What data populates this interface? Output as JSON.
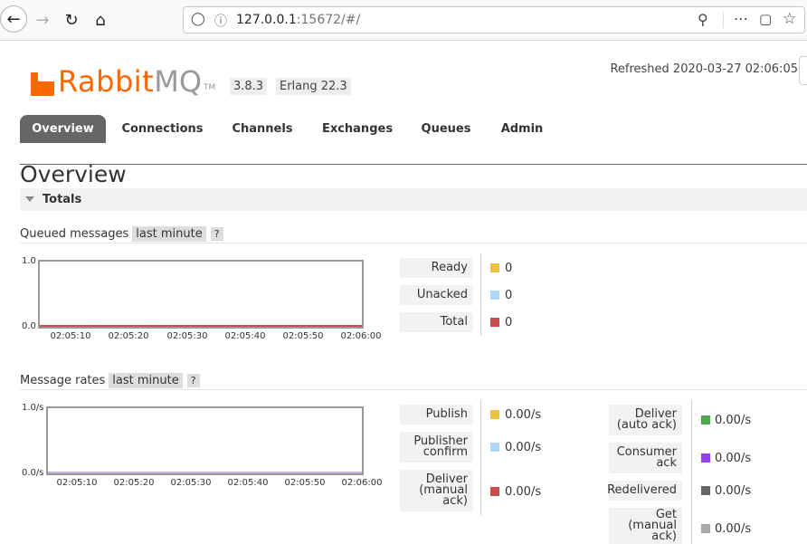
{
  "browser": {
    "url_host": "127.0.0.1",
    "url_rest": ":15672/#/"
  },
  "header": {
    "logo_text_1": "Rabbit",
    "logo_text_2": "MQ",
    "logo_tm": "TM",
    "version": "3.8.3",
    "erlang": "Erlang 22.3",
    "refreshed": "Refreshed 2020-03-27 02:06:05"
  },
  "tabs": [
    {
      "label": "Overview",
      "active": true
    },
    {
      "label": "Connections",
      "active": false
    },
    {
      "label": "Channels",
      "active": false
    },
    {
      "label": "Exchanges",
      "active": false
    },
    {
      "label": "Queues",
      "active": false
    },
    {
      "label": "Admin",
      "active": false
    }
  ],
  "page_title": "Overview",
  "section_totals": "Totals",
  "queued": {
    "label": "Queued messages",
    "range": "last minute",
    "help": "?",
    "y_top": "1.0",
    "y_bottom": "0.0",
    "x_ticks": [
      "02:05:10",
      "02:05:20",
      "02:05:30",
      "02:05:40",
      "02:05:50",
      "02:06:00"
    ],
    "legend": [
      {
        "label": "Ready",
        "value": "0",
        "color": "#edc240"
      },
      {
        "label": "Unacked",
        "value": "0",
        "color": "#afd8f8"
      },
      {
        "label": "Total",
        "value": "0",
        "color": "#cb4b4b"
      }
    ]
  },
  "rates": {
    "label": "Message rates",
    "range": "last minute",
    "help": "?",
    "y_top": "1.0/s",
    "y_bottom": "0.0/s",
    "x_ticks": [
      "02:05:10",
      "02:05:20",
      "02:05:30",
      "02:05:40",
      "02:05:50",
      "02:06:00"
    ],
    "legend_left": [
      {
        "lines": [
          "Publish"
        ],
        "value": "0.00/s",
        "color": "#edc240"
      },
      {
        "lines": [
          "Publisher",
          "confirm"
        ],
        "value": "0.00/s",
        "color": "#afd8f8"
      },
      {
        "lines": [
          "Deliver",
          "(manual",
          "ack)"
        ],
        "value": "0.00/s",
        "color": "#cb4b4b"
      }
    ],
    "legend_right": [
      {
        "lines": [
          "Deliver",
          "(auto ack)"
        ],
        "value": "0.00/s",
        "color": "#4da74d"
      },
      {
        "lines": [
          "Consumer",
          "ack"
        ],
        "value": "0.00/s",
        "color": "#9440ed"
      },
      {
        "lines": [
          "Redelivered"
        ],
        "value": "0.00/s",
        "color": "#666666"
      },
      {
        "lines": [
          "Get",
          "(manual",
          "ack)"
        ],
        "value": "0.00/s",
        "color": "#aaaaaa"
      }
    ]
  }
}
